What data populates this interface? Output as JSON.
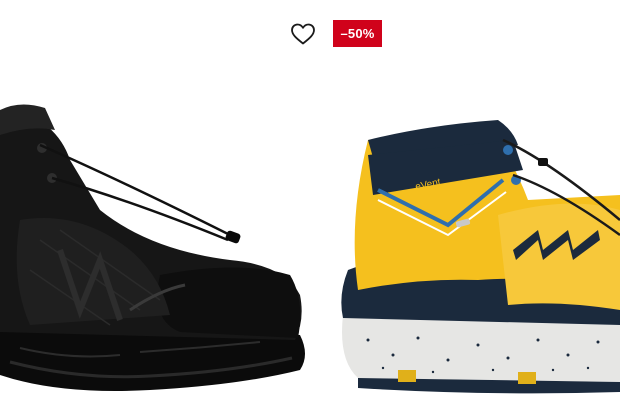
{
  "card": {
    "wishlist": {
      "icon": "heart-outline-icon"
    },
    "badge": {
      "text": "–50%",
      "color": "#d0021b"
    },
    "products": [
      {
        "name": "black-hiking-boot",
        "colors": {
          "main": "#141414",
          "sole": "#0a0a0a"
        }
      },
      {
        "name": "yellow-navy-hiking-boot",
        "colors": {
          "main": "#f5c01e",
          "navy": "#1b2a3d",
          "sole": "#e8e8e6",
          "accent": "#2f6fad"
        },
        "brand_text": "eVent"
      }
    ]
  }
}
